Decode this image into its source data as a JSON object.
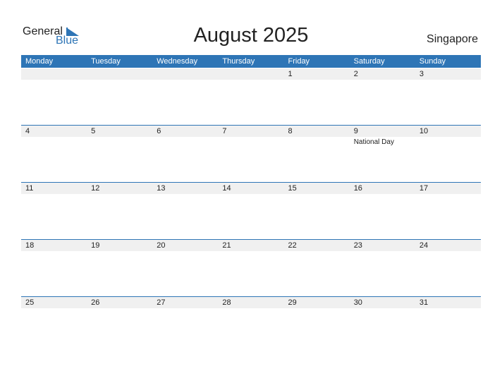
{
  "logo": {
    "general": "General",
    "blue": "Blue"
  },
  "title": "August 2025",
  "country": "Singapore",
  "colors": {
    "accent": "#2e75b6",
    "row_bg": "#f0f0f0"
  },
  "weekdays": [
    "Monday",
    "Tuesday",
    "Wednesday",
    "Thursday",
    "Friday",
    "Saturday",
    "Sunday"
  ],
  "weeks": [
    [
      "",
      "",
      "",
      "",
      "1",
      "2",
      "3"
    ],
    [
      "4",
      "5",
      "6",
      "7",
      "8",
      "9",
      "10"
    ],
    [
      "11",
      "12",
      "13",
      "14",
      "15",
      "16",
      "17"
    ],
    [
      "18",
      "19",
      "20",
      "21",
      "22",
      "23",
      "24"
    ],
    [
      "25",
      "26",
      "27",
      "28",
      "29",
      "30",
      "31"
    ]
  ],
  "holidays": [
    {
      "week": 1,
      "day": 5,
      "name": "National Day"
    }
  ]
}
